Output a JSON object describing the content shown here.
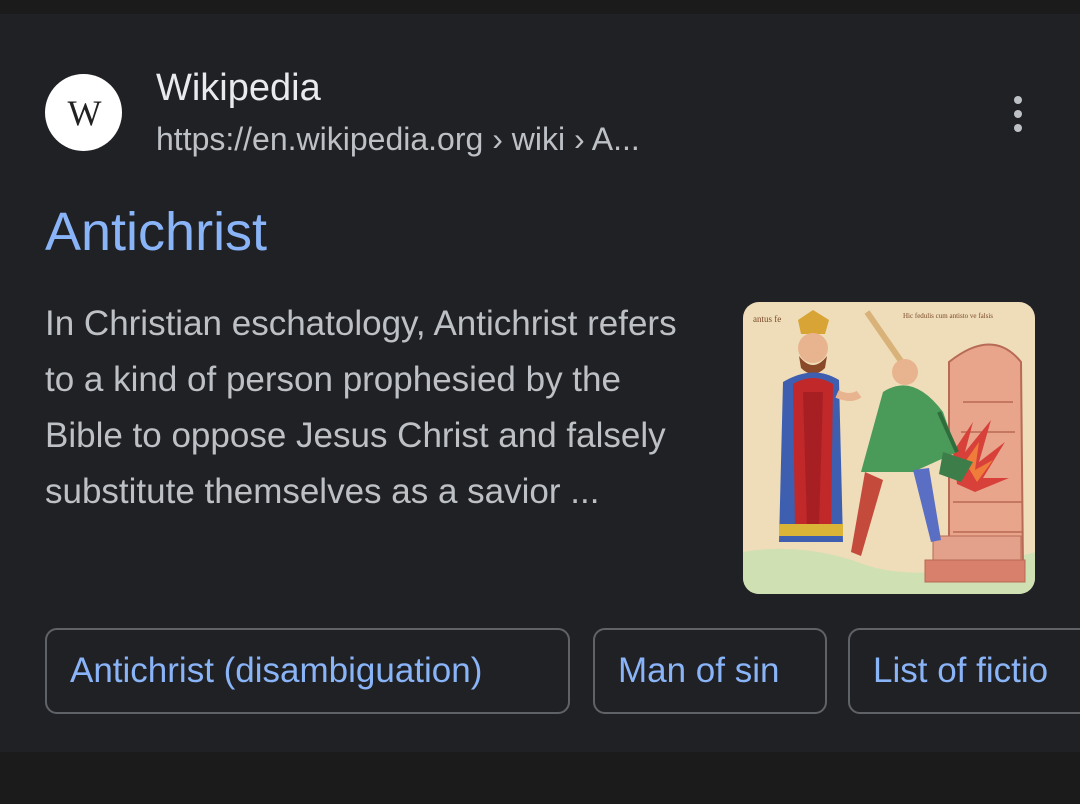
{
  "result": {
    "site_name": "Wikipedia",
    "favicon_letter": "W",
    "url": "https://en.wikipedia.org › wiki › A...",
    "title": "Antichrist",
    "snippet": "In Christian eschatology, Antichrist refers to a kind of person prophesied by the Bible to oppose Jesus Christ and falsely substitute themselves as a savior ...",
    "thumbnail_label_left": "antus fe",
    "thumbnail_label_right": "Hic fedulis cum antisto ve falsis",
    "more_icon": "more-vert-icon"
  },
  "chips": [
    {
      "label": "Antichrist (disambiguation)"
    },
    {
      "label": "Man of sin"
    },
    {
      "label": "List of fictio"
    }
  ],
  "colors": {
    "background": "#1b1b1b",
    "card": "#202124",
    "link": "#8ab4f8",
    "text_primary": "#e8eaed",
    "text_secondary": "#bdc1c6",
    "chip_border": "#5f6368"
  }
}
